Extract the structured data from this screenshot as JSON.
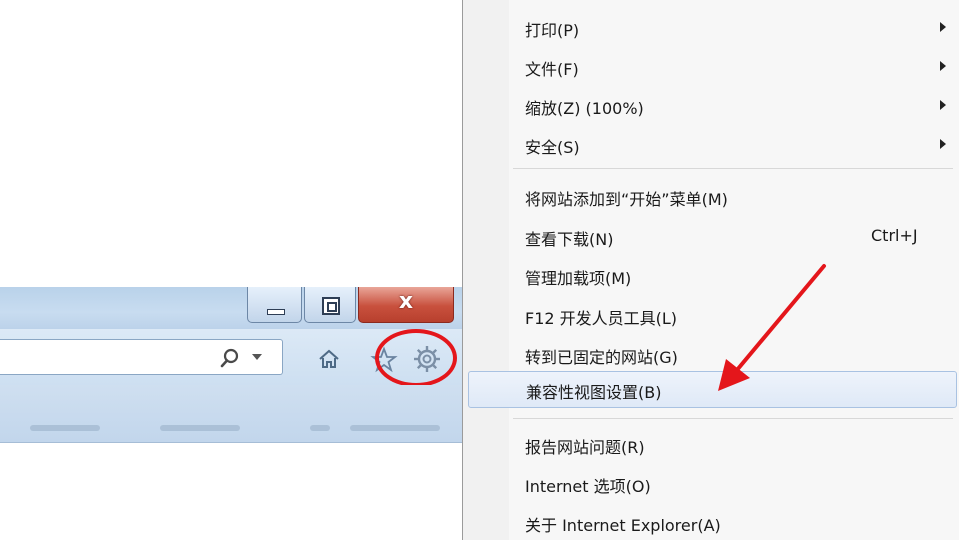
{
  "browser": {
    "titlebar": {
      "minimize_icon": "minimize-icon",
      "maximize_icon": "restore-icon",
      "close_label": "x"
    },
    "toolbar": {
      "search_icon": "search-icon",
      "dropdown_icon": "chevron-down-icon",
      "home_icon": "home-icon",
      "favorites_icon": "star-icon",
      "tools_icon": "gear-icon"
    }
  },
  "menu": {
    "items": [
      {
        "label": "打印(P)",
        "submenu": true
      },
      {
        "label": "文件(F)",
        "submenu": true
      },
      {
        "label": "缩放(Z) (100%)",
        "submenu": true
      },
      {
        "label": "安全(S)",
        "submenu": true
      },
      {
        "label": "将网站添加到“开始”菜单(M)"
      },
      {
        "label": "查看下载(N)",
        "shortcut": "Ctrl+J"
      },
      {
        "label": "管理加载项(M)"
      },
      {
        "label": "F12 开发人员工具(L)"
      },
      {
        "label": "转到已固定的网站(G)"
      },
      {
        "label": "兼容性视图设置(B)",
        "highlighted": true
      },
      {
        "label": "报告网站问题(R)"
      },
      {
        "label": "Internet 选项(O)"
      },
      {
        "label": "关于 Internet Explorer(A)"
      }
    ]
  },
  "annotations": {
    "circle_color": "#e4161b",
    "arrow_color": "#e4161b"
  }
}
